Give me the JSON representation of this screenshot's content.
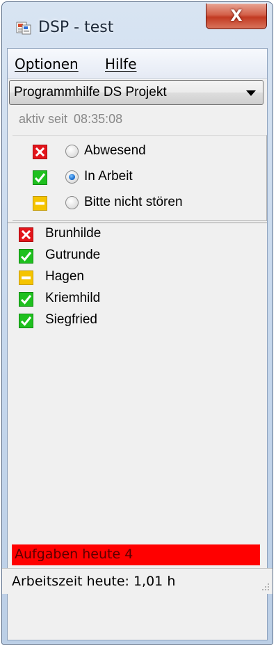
{
  "window": {
    "title": "DSP - test",
    "close_label": "X"
  },
  "menu": {
    "items": [
      {
        "label": "Optionen"
      },
      {
        "label": "Hilfe"
      }
    ]
  },
  "project_select": {
    "selected": "Programmhilfe DS Projekt"
  },
  "active_since": {
    "label": "aktiv seit",
    "time": "08:35:08"
  },
  "status_options": [
    {
      "label": "Abwesend",
      "icon": "red-x-icon",
      "checked": false
    },
    {
      "label": "In Arbeit",
      "icon": "green-check-icon",
      "checked": true
    },
    {
      "label": "Bitte nicht stören",
      "icon": "yellow-minus-icon",
      "checked": false
    }
  ],
  "users": [
    {
      "name": "Brunhilde",
      "icon": "red-x-icon"
    },
    {
      "name": "Gutrunde",
      "icon": "green-check-icon"
    },
    {
      "name": "Hagen",
      "icon": "yellow-minus-icon"
    },
    {
      "name": "Kriemhild",
      "icon": "green-check-icon"
    },
    {
      "name": "Siegfried",
      "icon": "green-check-icon"
    }
  ],
  "tasks": {
    "text": "Aufgaben heute 4"
  },
  "statusbar": {
    "text": "Arbeitszeit heute: 1,01 h"
  },
  "colors": {
    "absent": "#e3151b",
    "working": "#1fc01f",
    "dnd": "#f5c400",
    "alert": "#ff0000"
  }
}
